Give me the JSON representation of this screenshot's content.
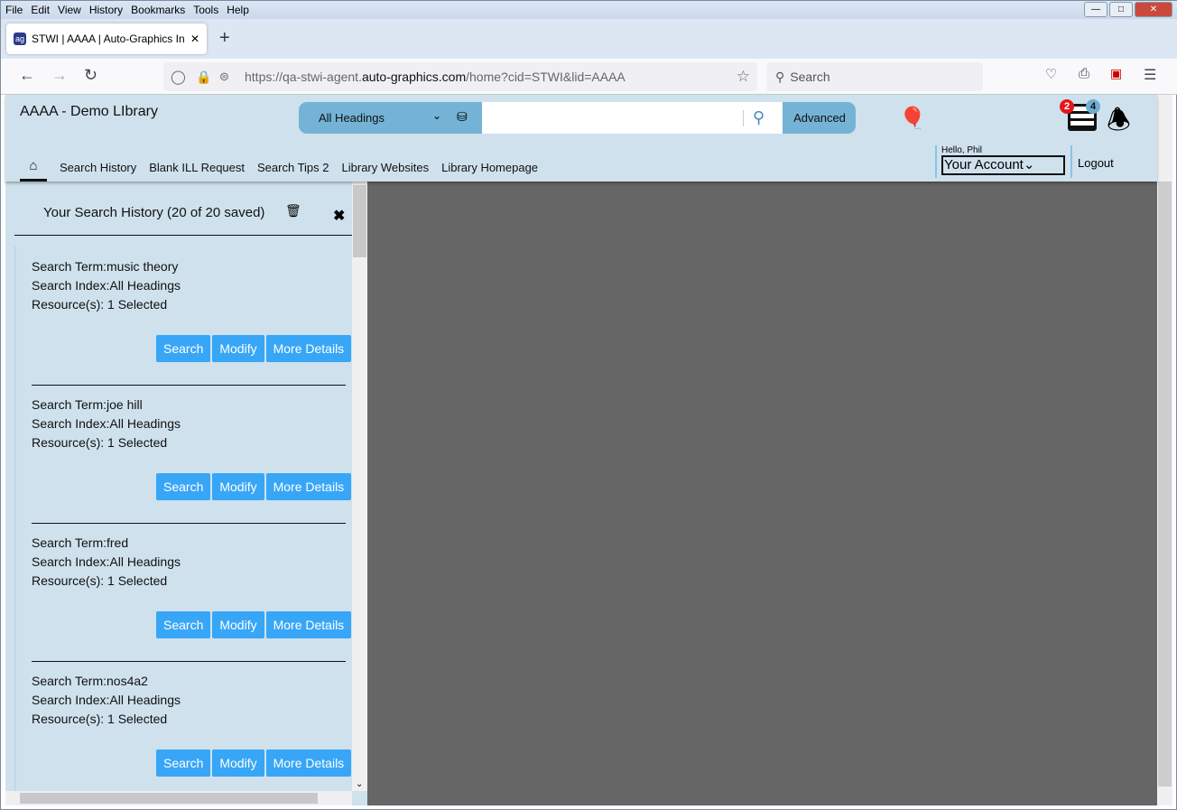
{
  "browser": {
    "menu": [
      "File",
      "Edit",
      "View",
      "History",
      "Bookmarks",
      "Tools",
      "Help"
    ],
    "tab_title": "STWI | AAAA | Auto-Graphics In",
    "url_prefix": "https://qa-stwi-agent.",
    "url_domain": "auto-graphics.com",
    "url_suffix": "/home?cid=STWI&lid=AAAA",
    "search_placeholder": "Search"
  },
  "header": {
    "library_name": "AAAA - Demo LIbrary",
    "search_index": "All Headings",
    "search_value": "",
    "advanced_label": "Advanced",
    "list_badge": "2",
    "list_badge_color": "#e8161b",
    "alert_badge": "4",
    "alert_badge_color": "#6eaed3",
    "nav": [
      "Search History",
      "Blank ILL Request",
      "Search Tips 2",
      "Library Websites",
      "Library Homepage"
    ],
    "greeting": "Hello, Phil",
    "account_label": "Your Account",
    "logout_label": "Logout"
  },
  "history": {
    "title": "Your Search History (20 of 20 saved)",
    "button_color": "#38a6f7",
    "entries": [
      {
        "term": "Search Term:music theory",
        "index": "Search Index:All Headings",
        "resources": "Resource(s): 1 Selected",
        "search": "Search",
        "modify": "Modify",
        "details": "More Details"
      },
      {
        "term": "Search Term:joe hill",
        "index": "Search Index:All Headings",
        "resources": "Resource(s): 1 Selected",
        "search": "Search",
        "modify": "Modify",
        "details": "More Details"
      },
      {
        "term": "Search Term:fred",
        "index": "Search Index:All Headings",
        "resources": "Resource(s): 1 Selected",
        "search": "Search",
        "modify": "Modify",
        "details": "More Details"
      },
      {
        "term": "Search Term:nos4a2",
        "index": "Search Index:All Headings",
        "resources": "Resource(s): 1 Selected",
        "search": "Search",
        "modify": "Modify",
        "details": "More Details"
      }
    ]
  }
}
